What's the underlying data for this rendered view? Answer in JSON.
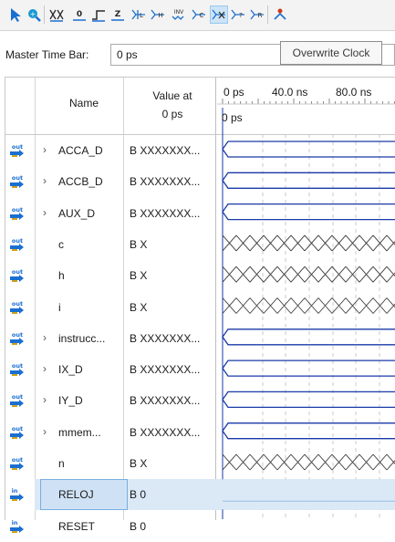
{
  "toolbar": {
    "icons": [
      "pointer-icon",
      "zoom-icon",
      "unknown-value-icon",
      "force-low-icon",
      "force-high-icon",
      "high-impedance-icon",
      "invert-icon",
      "weak-high-icon",
      "weak-low-icon",
      "count-value-icon",
      "overwrite-clock-icon",
      "random-value-icon",
      "arbitrary-value-icon",
      "snap-to-transition-icon"
    ]
  },
  "master_time_bar": {
    "label": "Master Time Bar:",
    "value": "0 ps"
  },
  "tooltip": {
    "text": "Overwrite Clock"
  },
  "header": {
    "name": "Name",
    "value_line1": "Value at",
    "value_line2": "0 ps"
  },
  "timeline": {
    "t0": "0 ps",
    "t1": "40.0 ns",
    "t2": "80.0 ns",
    "cursor": "0 ps"
  },
  "signals": [
    {
      "dir": "out",
      "name": "ACCA_D",
      "value": "B XXXXXXX...",
      "group": true,
      "wave": "bus"
    },
    {
      "dir": "out",
      "name": "ACCB_D",
      "value": "B XXXXXXX...",
      "group": true,
      "wave": "bus"
    },
    {
      "dir": "out",
      "name": "AUX_D",
      "value": "B XXXXXXX...",
      "group": true,
      "wave": "bus"
    },
    {
      "dir": "out",
      "name": "c",
      "value": "B X",
      "group": false,
      "wave": "x"
    },
    {
      "dir": "out",
      "name": "h",
      "value": "B X",
      "group": false,
      "wave": "x"
    },
    {
      "dir": "out",
      "name": "i",
      "value": "B X",
      "group": false,
      "wave": "x"
    },
    {
      "dir": "out",
      "name": "instrucc...",
      "value": "B XXXXXXX...",
      "group": true,
      "wave": "bus"
    },
    {
      "dir": "out",
      "name": "IX_D",
      "value": "B XXXXXXX...",
      "group": true,
      "wave": "bus"
    },
    {
      "dir": "out",
      "name": "IY_D",
      "value": "B XXXXXXX...",
      "group": true,
      "wave": "bus"
    },
    {
      "dir": "out",
      "name": "mmem...",
      "value": "B XXXXXXX...",
      "group": true,
      "wave": "bus"
    },
    {
      "dir": "out",
      "name": "n",
      "value": "B X",
      "group": false,
      "wave": "x"
    },
    {
      "dir": "in",
      "name": "RELOJ",
      "value": "B 0",
      "group": false,
      "wave": "selected"
    },
    {
      "dir": "in",
      "name": "RESET",
      "value": "B 0",
      "group": false,
      "wave": "low"
    }
  ],
  "colors": {
    "wave": "#1a3aa8",
    "selected": "#dbe9f7",
    "selected_wave": "#a9c8e8"
  }
}
